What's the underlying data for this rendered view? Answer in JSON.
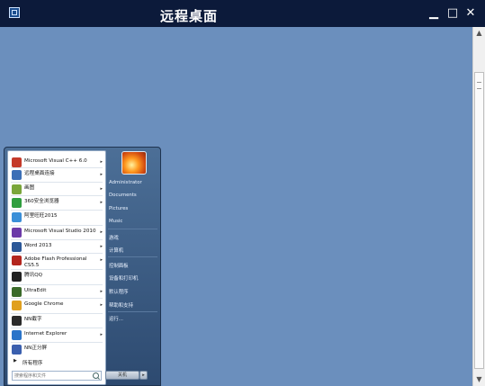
{
  "window": {
    "title": "远程桌面",
    "minimize": "▁",
    "maximize": "□",
    "close": "✕"
  },
  "start_menu": {
    "apps": [
      {
        "label": "Microsoft Visual C++ 6.0",
        "arrow": "▸",
        "icon": "visual-cpp-icon",
        "color": "#c43a2a"
      },
      {
        "label": "远程桌面连接",
        "arrow": "▸",
        "icon": "remote-desktop-icon",
        "color": "#3c6fb6"
      },
      {
        "label": "画图",
        "arrow": "▸",
        "icon": "paint-icon",
        "color": "#7aa63a"
      },
      {
        "label": "360安全浏览器",
        "arrow": "▸",
        "icon": "360-browser-icon",
        "color": "#2f9e3f"
      },
      {
        "label": "阿里旺旺2015",
        "arrow": "",
        "icon": "aliwangwang-icon",
        "color": "#3a8fd8"
      },
      {
        "label": "Microsoft Visual Studio 2010",
        "arrow": "▸",
        "icon": "visual-studio-icon",
        "color": "#6c3aa8"
      },
      {
        "label": "Word 2013",
        "arrow": "▸",
        "icon": "word-icon",
        "color": "#2b5797"
      },
      {
        "label": "Adobe Flash Professional",
        "label2": "CS5.5",
        "arrow": "▸",
        "icon": "flash-icon",
        "color": "#b3261e"
      },
      {
        "label": "腾讯QQ",
        "arrow": "",
        "icon": "qq-icon",
        "color": "#222222"
      },
      {
        "label": "UltraEdit",
        "arrow": "▸",
        "icon": "ultraedit-icon",
        "color": "#3a6a2a"
      },
      {
        "label": "Google Chrome",
        "arrow": "▸",
        "icon": "chrome-icon",
        "color": "#e0a020"
      },
      {
        "label": "NN截字",
        "arrow": "",
        "icon": "nn-capture-icon",
        "color": "#2a2a2a"
      },
      {
        "label": "Internet Explorer",
        "arrow": "▸",
        "icon": "ie-icon",
        "color": "#2a74c9"
      },
      {
        "label": "NN正分屏",
        "arrow": "",
        "icon": "nn-split-icon",
        "color": "#3a5fae"
      }
    ],
    "all_programs": {
      "arrow": "▶",
      "label": "所有程序"
    },
    "search_placeholder": "搜索程序和文件",
    "right_items": [
      {
        "label": "Administrator",
        "sep_after": false
      },
      {
        "label": "Documents",
        "sep_after": false
      },
      {
        "label": "Pictures",
        "sep_after": false
      },
      {
        "label": "Music",
        "sep_after": true
      },
      {
        "label": "游戏",
        "sep_after": false
      },
      {
        "label": "计算机",
        "sep_after": true
      },
      {
        "label": "控制面板",
        "sep_after": false
      },
      {
        "label": "设备和打印机",
        "sep_after": false
      },
      {
        "label": "默认程序",
        "sep_after": false
      },
      {
        "label": "帮助和支持",
        "sep_after": true
      },
      {
        "label": "运行...",
        "sep_after": false
      }
    ],
    "shutdown_label": "关机",
    "shutdown_arrow": "▸"
  },
  "scrollbar": {
    "up": "▲",
    "down": "▼"
  }
}
